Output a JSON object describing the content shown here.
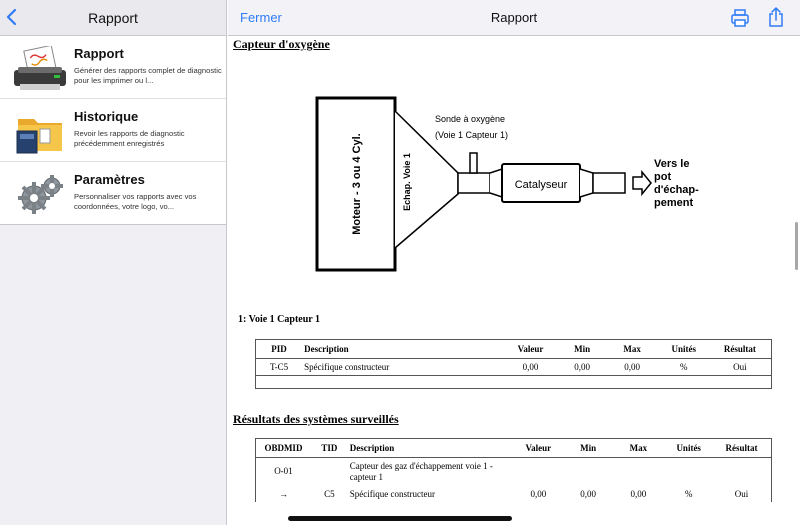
{
  "left": {
    "title": "Rapport",
    "items": [
      {
        "title": "Rapport",
        "desc": "Générer des rapports complet de diagnostic pour les imprimer ou l...",
        "icon": "printer-report-icon"
      },
      {
        "title": "Historique",
        "desc": "Revoir les rapports de diagnostic précédemment enregistrés",
        "icon": "folder-archive-icon"
      },
      {
        "title": "Paramètres",
        "desc": "Personnaliser vos rapports avec vos coordonnées, votre logo, vo...",
        "icon": "gears-icon"
      }
    ]
  },
  "right": {
    "close_label": "Fermer",
    "title": "Rapport",
    "accent": "#2f7cf6"
  },
  "doc": {
    "oxygen_heading": "Capteur d'oxygène",
    "diagram": {
      "engine": "Moteur - 3 ou 4 Cyl.",
      "exhaust": "Echap. Voie 1",
      "probe_line1": "Sonde à oxygène",
      "probe_line2": "(Voie 1 Capteur 1)",
      "catalyst": "Catalyseur",
      "to_line1": "Vers le",
      "to_line2": "pot",
      "to_line3": "d'échap-",
      "to_line4": "pement"
    },
    "sensor_label": "1: Voie 1 Capteur 1",
    "table1": {
      "headers": [
        "PID",
        "Description",
        "Valeur",
        "Min",
        "Max",
        "Unités",
        "Résultat"
      ],
      "row": [
        "T-C5",
        "Spécifique constructeur",
        "0,00",
        "0,00",
        "0,00",
        "%",
        "Oui"
      ]
    },
    "monitored_heading": "Résultats des systèmes surveillés",
    "table2": {
      "headers": [
        "OBDMID",
        "TID",
        "Description",
        "Valeur",
        "Min",
        "Max",
        "Unités",
        "Résultat"
      ],
      "group_id": "O-01",
      "group_desc": "Capteur des gaz d'échappement voie 1 - capteur 1",
      "row": [
        "→",
        "C5",
        "Spécifique constructeur",
        "0,00",
        "0,00",
        "0,00",
        "%",
        "Oui"
      ]
    }
  }
}
